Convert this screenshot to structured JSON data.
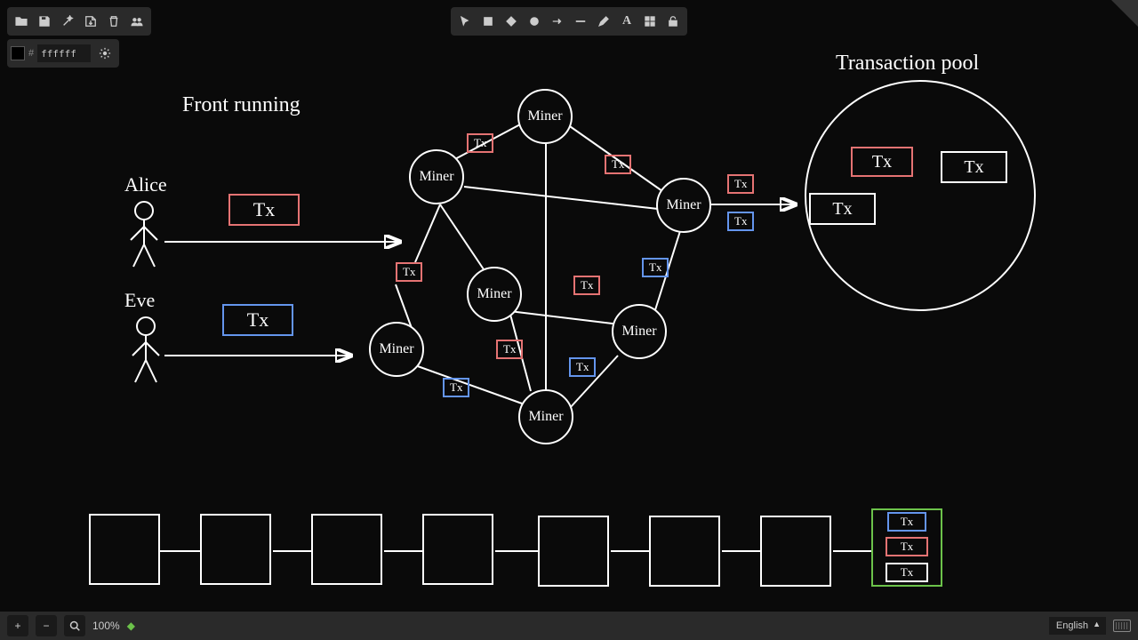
{
  "toolbar_left": {
    "open": "folder-open-icon",
    "save": "save-icon",
    "wizard": "wand-icon",
    "export": "export-icon",
    "delete": "trash-icon",
    "share": "users-icon"
  },
  "color_toolbar": {
    "hash": "#",
    "value": "ffffff",
    "settings": "gear-icon"
  },
  "toolbar_center": {
    "select": "select-arrow-icon",
    "rect": "square-icon",
    "diamond": "diamond-icon",
    "circle": "circle-icon",
    "arrow": "arrow-right-icon",
    "line": "line-icon",
    "pen": "pencil-icon",
    "text": "A",
    "grid": "grid-icon",
    "lock": "unlock-icon"
  },
  "diagram": {
    "title": "Front running",
    "pool_title": "Transaction pool",
    "alice": "Alice",
    "eve": "Eve",
    "miner_label": "Miner",
    "tx_label": "Tx"
  },
  "bottom": {
    "zoom": "100%",
    "language": "English"
  }
}
